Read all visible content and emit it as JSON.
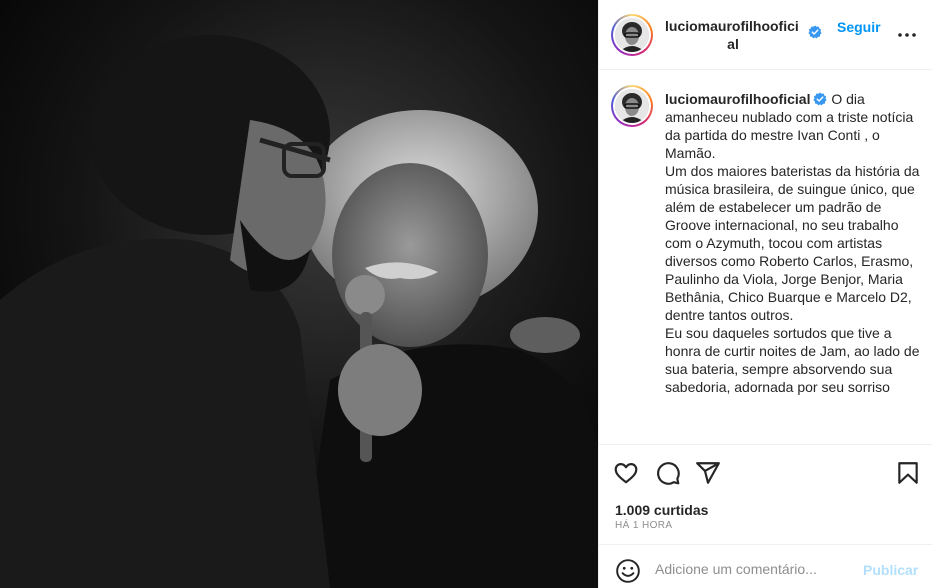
{
  "post": {
    "photo_alt": "",
    "username": "luciomaurofilhooficial",
    "username_line1": "luciomaurofilhoofici",
    "username_line2": "al",
    "follow_label": "Seguir",
    "caption": "O dia amanheceu nublado com a triste notícia da partida do mestre Ivan Conti , o Mamão.\nUm dos maiores bateristas da história da música brasileira, de suingue único, que além de estabelecer um padrão de Groove internacional, no seu trabalho com o Azymuth, tocou com artistas diversos como Roberto Carlos, Erasmo, Paulinho da Viola, Jorge Benjor, Maria Bethânia, Chico Buarque e Marcelo D2, dentre tantos outros.\nEu sou daqueles sortudos que tive a honra de curtir noites de Jam, ao lado de sua bateria, sempre absorvendo sua sabedoria, adornada por seu sorriso",
    "likes": "1.009 curtidas",
    "time": "HÁ 1 HORA"
  },
  "comment": {
    "placeholder": "Adicione um comentário...",
    "publish_label": "Publicar"
  },
  "colors": {
    "accent": "#0095f6",
    "publish_disabled": "#b2dffc",
    "text": "#262626",
    "muted": "#8e8e8e"
  },
  "icons": [
    "verified-icon",
    "more-options-icon",
    "heart-icon",
    "comment-icon",
    "share-icon",
    "bookmark-icon",
    "emoji-icon"
  ]
}
